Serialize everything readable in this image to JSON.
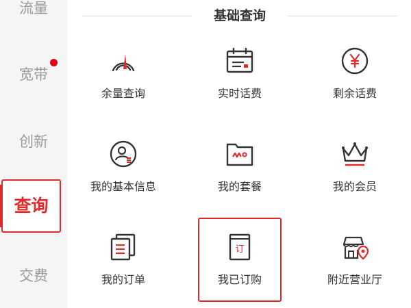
{
  "sidebar": {
    "items": [
      {
        "label": "流量",
        "active": false
      },
      {
        "label": "宽带",
        "active": false,
        "badge": true
      },
      {
        "label": "创新",
        "active": false
      },
      {
        "label": "查询",
        "active": true
      },
      {
        "label": "交费",
        "active": false
      }
    ]
  },
  "section": {
    "title": "基础查询",
    "items": [
      {
        "label": "余量查询",
        "icon": "speedometer-icon"
      },
      {
        "label": "实时话费",
        "icon": "calendar-bill-icon"
      },
      {
        "label": "剩余话费",
        "icon": "yen-coin-icon"
      },
      {
        "label": "我的基本信息",
        "icon": "user-info-icon"
      },
      {
        "label": "我的套餐",
        "icon": "package-folder-icon"
      },
      {
        "label": "我的会员",
        "icon": "crown-icon"
      },
      {
        "label": "我的订单",
        "icon": "order-list-icon"
      },
      {
        "label": "我已订购",
        "icon": "subscribed-book-icon",
        "badge_char": "订",
        "highlighted": true
      },
      {
        "label": "附近营业厅",
        "icon": "store-location-icon"
      }
    ]
  },
  "colors": {
    "accent": "#e02a2a",
    "icon_stroke": "#333333",
    "sidebar_bg": "#f5f5f5",
    "inactive_text": "#9a9a9a"
  }
}
